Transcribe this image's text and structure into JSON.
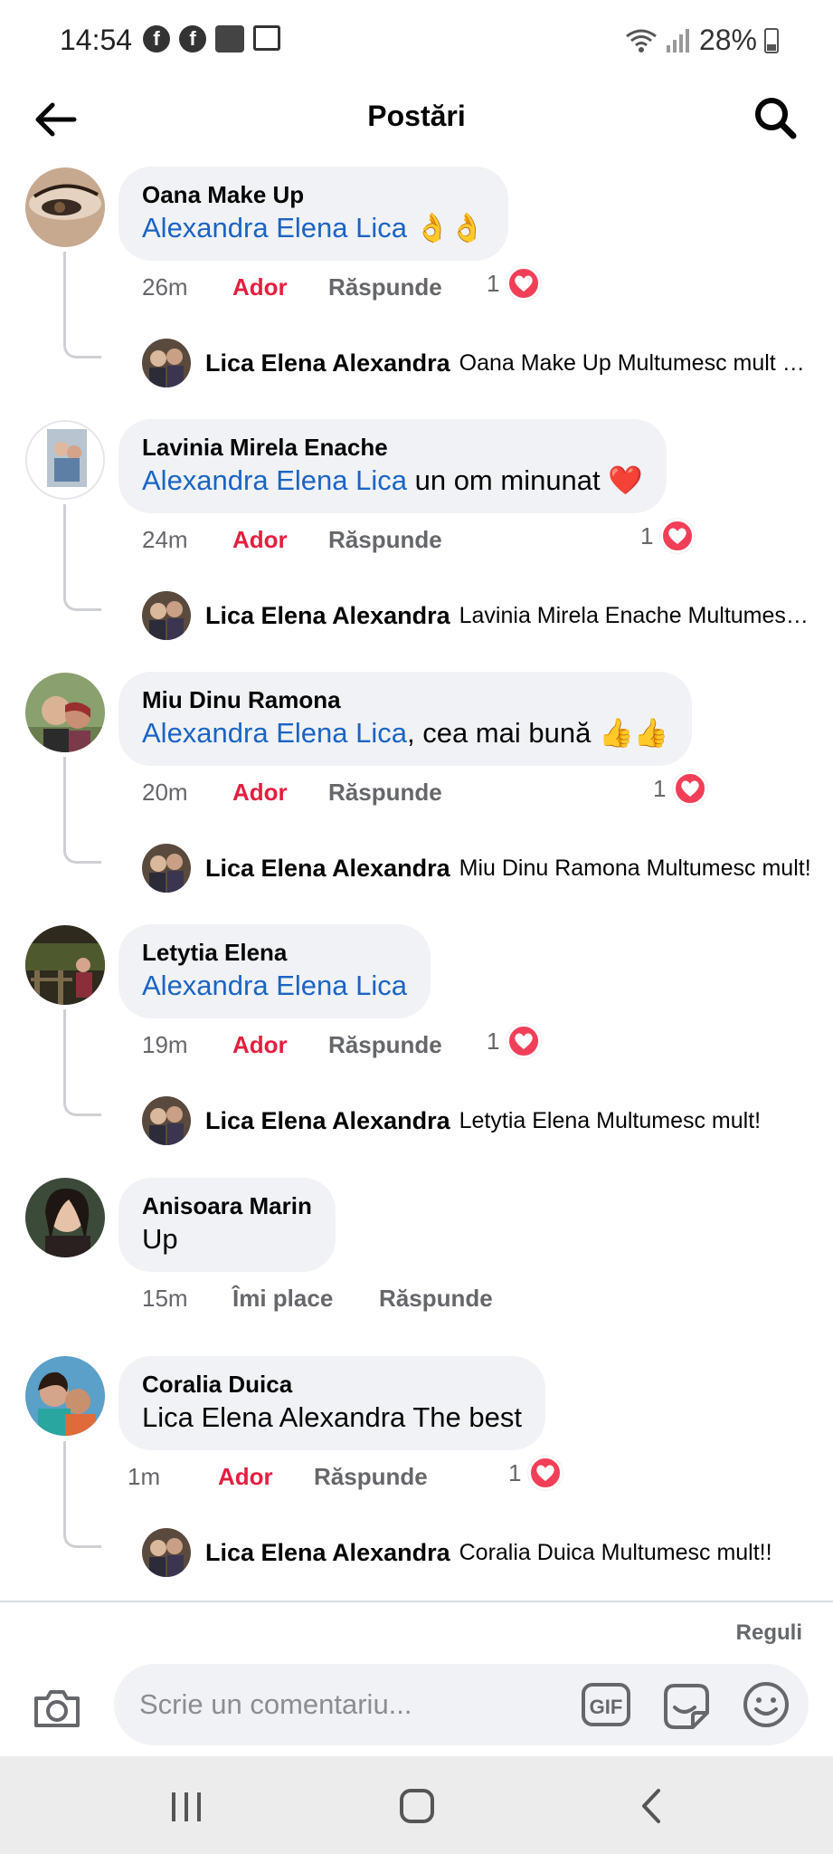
{
  "status_bar": {
    "time": "14:54",
    "battery": "28%"
  },
  "header": {
    "title": "Postări"
  },
  "comments": [
    {
      "author": "Oana Make Up",
      "mention": "Alexandra Elena Lica",
      "text": " 👌👌",
      "time": "26m",
      "like_label": "Ador",
      "reply_label": "Răspunde",
      "reactions": "1",
      "reply": {
        "author": "Lica Elena Alexandra",
        "text": "Oana Make Up Multumesc mult mult!"
      }
    },
    {
      "author": "Lavinia Mirela Enache",
      "mention": "Alexandra Elena Lica",
      "text": "  un om minunat ❤️",
      "time": "24m",
      "like_label": "Ador",
      "reply_label": "Răspunde",
      "reactions": "1",
      "reply": {
        "author": "Lica Elena Alexandra",
        "text": "Lavinia Mirela Enache Multumesc mult!"
      }
    },
    {
      "author": "Miu Dinu Ramona",
      "mention": "Alexandra Elena Lica",
      "text": ", cea mai bună 👍👍",
      "time": "20m",
      "like_label": "Ador",
      "reply_label": "Răspunde",
      "reactions": "1",
      "reply": {
        "author": "Lica Elena Alexandra",
        "text": "Miu Dinu Ramona Multumesc mult!"
      }
    },
    {
      "author": "Letytia Elena",
      "mention": "Alexandra Elena Lica",
      "text": "",
      "time": "19m",
      "like_label": "Ador",
      "reply_label": "Răspunde",
      "reactions": "1",
      "reply": {
        "author": "Lica Elena Alexandra",
        "text": "Letytia Elena Multumesc mult!"
      }
    },
    {
      "author": "Anisoara Marin",
      "mention": "",
      "text": "Up",
      "time": "15m",
      "like_label": "Îmi place",
      "reply_label": "Răspunde"
    },
    {
      "author": "Coralia Duica",
      "mention": "",
      "text": "Lica Elena Alexandra The best",
      "time": "1m",
      "like_label": "Ador",
      "reply_label": "Răspunde",
      "reactions": "1",
      "reply": {
        "author": "Lica Elena Alexandra",
        "text": "Coralia Duica Multumesc mult!!"
      }
    }
  ],
  "composer": {
    "rules_label": "Reguli",
    "placeholder": "Scrie un comentariu..."
  },
  "colors": {
    "accent_link": "#1b64c4",
    "reaction_red": "#e41e3f",
    "bubble_bg": "#f0f2f5"
  },
  "icons": [
    "back-arrow-icon",
    "search-icon",
    "heart-reaction-icon",
    "camera-icon",
    "gif-icon",
    "sticker-icon",
    "emoji-icon"
  ]
}
